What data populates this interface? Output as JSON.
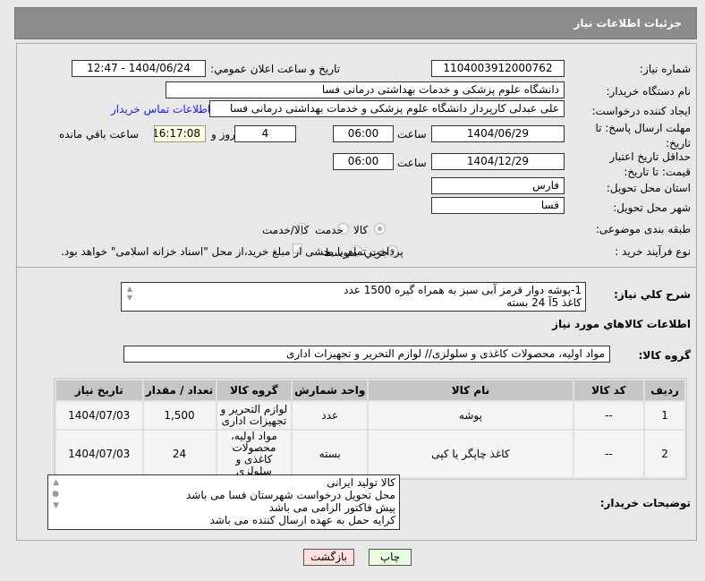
{
  "header": {
    "title": "جزئیات اطلاعات نیاز"
  },
  "form": {
    "need_number_label": "شماره نیاز:",
    "need_number": "1104003912000762",
    "announce_label": "تاریخ و ساعت اعلان عمومي:",
    "announce_value": "1404/06/24 - 12:47",
    "buyer_org_label": "نام دستگاه خريدار:",
    "buyer_org": "دانشگاه علوم پزشکی و خدمات بهداشتی درمانی فسا",
    "creator_label": "ايجاد کننده درخواست:",
    "creator": "علی عبدلی کارپرداز دانشگاه علوم پزشکی و خدمات بهداشتی درمانی فسا",
    "contact_link": "اطلاعات تماس خريدار",
    "deadline_label": "مهلت ارسال پاسخ: تا تاريخ:",
    "deadline_date": "1404/06/29",
    "time_label": "ساعت",
    "deadline_time": "06:00",
    "days": "4",
    "days_label": "روز و",
    "remaining": "16:17:08",
    "remaining_label": "ساعت باقي مانده",
    "validity_label": "حداقل تاريخ اعتبار قيمت: تا تاريخ:",
    "validity_date": "1404/12/29",
    "validity_time": "06:00",
    "province_label": "استان محل تحويل:",
    "province": "فارس",
    "city_label": "شهر محل تحويل:",
    "city": "فسا",
    "category_label": "طبقه بندی موضوعی:",
    "category_options": [
      "کالا",
      "خدمت",
      "کالا/خدمت"
    ],
    "category_selected": "کالا",
    "process_label": "نوع فرآيند خريد :",
    "process_options": [
      "جزيي",
      "متوسط"
    ],
    "process_selected": "جزيي",
    "payment_note": "پرداخت تمام يا بخشی از مبلغ خريد،از محل \"اسناد خزانه اسلامی\" خواهد بود."
  },
  "description": {
    "label": "شرح کلي نياز:",
    "lines": [
      "1-پوشه دوار قرمز آبی سبز به همراه گیره      1500 عدد",
      "کاغذ 5آ   24 بسته"
    ]
  },
  "goods": {
    "heading": "اطلاعات کالاهاي مورد نياز",
    "group_label": "گروه کالا:",
    "group_value": "مواد اولیه، محصولات کاغذی و سلولزی// لوازم التحریر و تجهیزات اداری",
    "columns": [
      "رديف",
      "کد کالا",
      "نام کالا",
      "واحد شمارش",
      "گروه کالا",
      "تعداد / مقدار",
      "تاريخ نياز"
    ],
    "rows": [
      [
        "1",
        "--",
        "پوشه",
        "عدد",
        "لوازم التحرير و تجهيزات اداری",
        "1,500",
        "1404/07/03"
      ],
      [
        "2",
        "--",
        "کاغذ چاپگر يا کپی",
        "بسته",
        "مواد اوليه، محصولات کاغذی و سلولزی",
        "24",
        "1404/07/03"
      ]
    ]
  },
  "notes": {
    "label": "توضيحات خريدار:",
    "lines": [
      "کالا تولید ایرانی",
      "محل تحویل درخواست شهرستان فسا می باشد",
      "پیش فاکتور الزامی می باشد",
      "کرایه حمل به عهده ارسال کننده می باشد"
    ]
  },
  "buttons": {
    "print": "چاپ",
    "back": "بازگشت",
    "print_color": "#e6ffe0",
    "back_color": "#ffe0e0"
  }
}
